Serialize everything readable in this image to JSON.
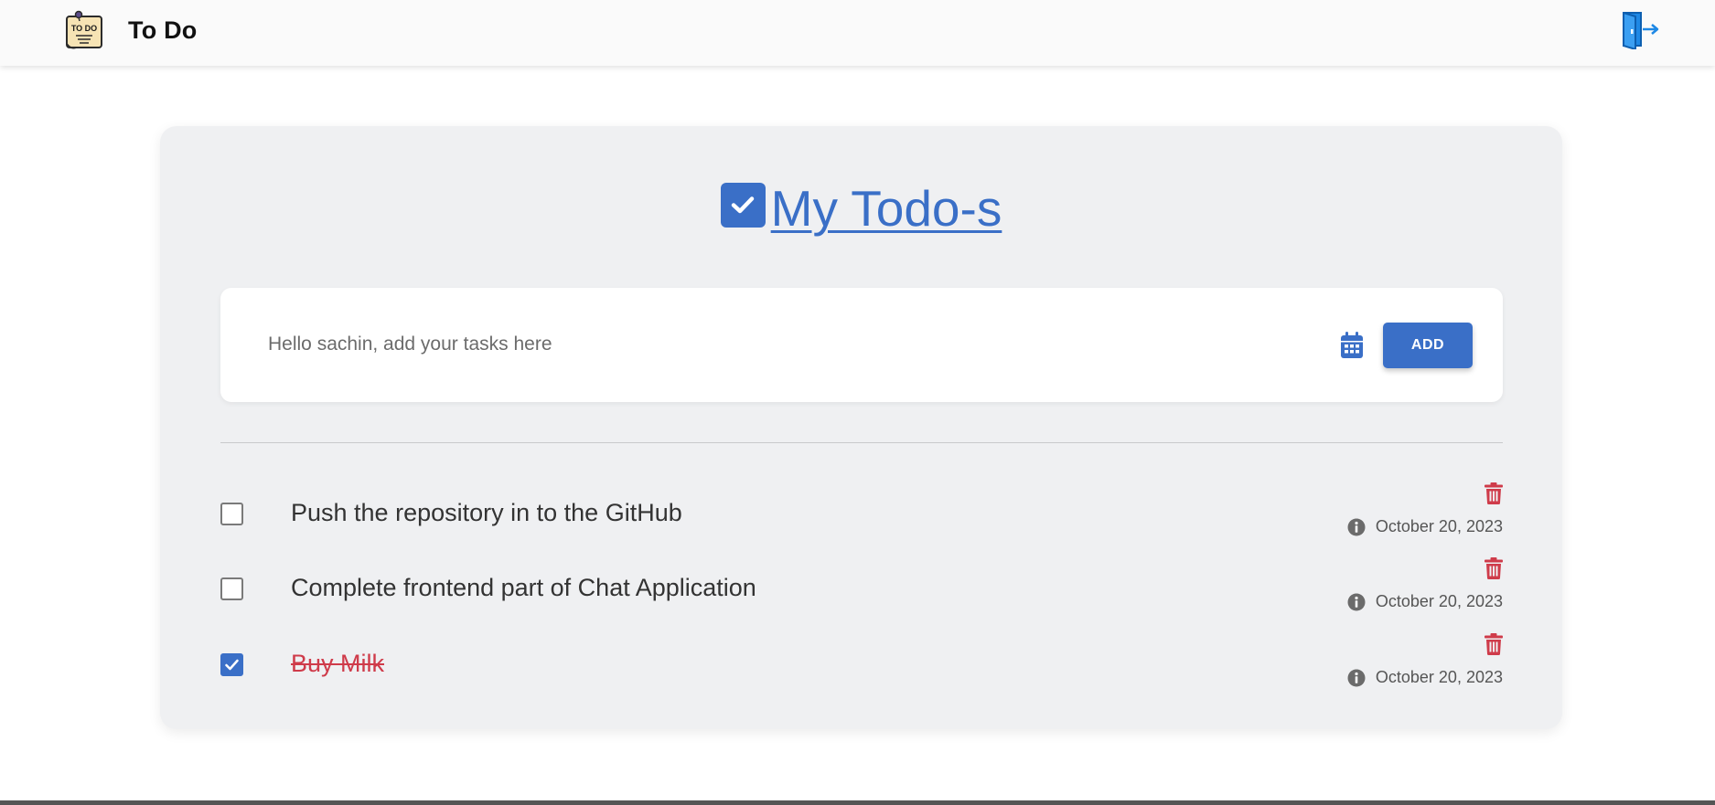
{
  "navbar": {
    "brand_title": "To Do",
    "logo_text": "TO DO",
    "logout_icon": "logout-door-icon"
  },
  "main": {
    "heading": "My Todo-s",
    "input": {
      "placeholder": "Hello sachin, add your tasks here",
      "value": ""
    },
    "add_button_label": "ADD"
  },
  "todos": [
    {
      "text": "Push the repository in to the GitHub",
      "completed": false,
      "date": "October 20, 2023"
    },
    {
      "text": "Complete frontend part of Chat Application",
      "completed": false,
      "date": "October 20, 2023"
    },
    {
      "text": "Buy Milk",
      "completed": true,
      "date": "October 20, 2023"
    }
  ],
  "colors": {
    "accent": "#3a6fc7",
    "danger": "#cf3b4a",
    "card_bg": "#eff0f2",
    "logout_blue": "#1e88e5"
  }
}
